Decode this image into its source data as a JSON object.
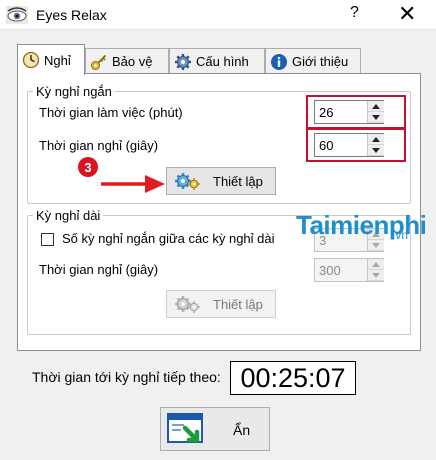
{
  "window": {
    "title": "Eyes Relax",
    "help_glyph": "?",
    "close_glyph": "✕"
  },
  "tabs": [
    {
      "label": "Nghỉ",
      "icon": "clock-icon",
      "active": true
    },
    {
      "label": "Bảo vệ",
      "icon": "key-icon",
      "active": false
    },
    {
      "label": "Cấu hình",
      "icon": "gear-icon",
      "active": false
    },
    {
      "label": "Giới thiệu",
      "icon": "info-icon",
      "active": false
    }
  ],
  "short_break": {
    "legend": "Kỳ nghỉ ngắn",
    "work_time_label": "Thời gian làm việc (phút)",
    "work_time_value": "26",
    "rest_time_label": "Thời gian nghỉ (giây)",
    "rest_time_value": "60",
    "setup_button": "Thiết lập",
    "step_marker": "3"
  },
  "long_break": {
    "legend": "Kỳ nghỉ dài",
    "count_label": "Số kỳ nghỉ ngắn giữa các kỳ nghỉ dài",
    "count_value": "3",
    "count_checked": false,
    "rest_time_label": "Thời gian nghỉ (giây)",
    "rest_time_value": "300",
    "setup_button": "Thiết lập"
  },
  "watermark": {
    "text": "Taimienphi",
    "suffix": ".vn"
  },
  "footer": {
    "next_break_label": "Thời gian tới kỳ nghỉ tiếp theo:",
    "countdown": "00:25:07",
    "hide_button": "Ẩn"
  },
  "colors": {
    "highlight": "#c8102e",
    "watermark": "#1e8fc9"
  }
}
